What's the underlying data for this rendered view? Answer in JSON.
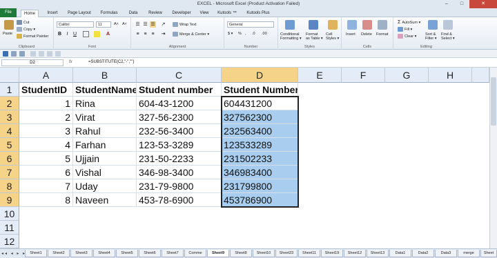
{
  "window": {
    "title": "EXCEL - Microsoft Excel (Product Activation Failed)",
    "buttons": [
      "–",
      "□",
      "✕"
    ]
  },
  "ribbon_tabs": [
    "File",
    "Home",
    "Insert",
    "Page Layout",
    "Formulas",
    "Data",
    "Review",
    "Developer",
    "View",
    "Kutools ™",
    "Kutools Plus"
  ],
  "active_tab": "Home",
  "ribbon": {
    "clipboard": {
      "paste": "Paste",
      "cut": "Cut",
      "copy": "Copy ▾",
      "format_painter": "Format Painter",
      "label": "Clipboard"
    },
    "font": {
      "name": "Calibri",
      "size": "11",
      "grow": "A˄",
      "shrink": "A˅",
      "bold": "B",
      "italic": "I",
      "underline": "U",
      "label": "Font"
    },
    "alignment": {
      "wrap_text": "Wrap Text",
      "merge_center": "Merge & Center ▾",
      "label": "Alignment"
    },
    "number": {
      "format": "General",
      "currency": "$ ▾",
      "percent": "%",
      "comma": ",",
      "inc_dec": ".0",
      "dec_dec": ".00",
      "label": "Number"
    },
    "styles": {
      "cond": "Conditional",
      "cond2": "Formatting ▾",
      "table": "Format",
      "table2": "as Table ▾",
      "cell": "Cell",
      "cell2": "Styles ▾",
      "label": "Styles"
    },
    "cells": {
      "insert": "Insert",
      "delete": "Delete",
      "format": "Format",
      "label": "Cells"
    },
    "editing": {
      "autosum": "AutoSum ▾",
      "fill": "Fill ▾",
      "clear": "Clear ▾",
      "sort": "Sort &",
      "sort2": "Filter ▾",
      "find": "Find &",
      "find2": "Select ▾",
      "label": "Editing"
    }
  },
  "formula_bar": {
    "name_box": "D2",
    "fx": "fx",
    "formula": "=SUBSTITUTE(C2,\"-\",\"\")"
  },
  "columns": [
    "A",
    "B",
    "C",
    "D",
    "E",
    "F",
    "G",
    "H"
  ],
  "selected_column": "D",
  "rows": [
    "1",
    "2",
    "3",
    "4",
    "5",
    "6",
    "7",
    "8",
    "9",
    "10",
    "11",
    "12"
  ],
  "table": {
    "header": [
      "StudentID",
      "StudentName",
      "Student number",
      "Student Number"
    ],
    "data": [
      [
        "1",
        "Rina",
        "604-43-1200",
        "604431200"
      ],
      [
        "2",
        "Virat",
        "327-56-2300",
        "327562300"
      ],
      [
        "3",
        "Rahul",
        "232-56-3400",
        "232563400"
      ],
      [
        "4",
        "Farhan",
        "123-53-3289",
        "123533289"
      ],
      [
        "5",
        "Ujjain",
        "231-50-2233",
        "231502233"
      ],
      [
        "6",
        "Vishal",
        "346-98-3400",
        "346983400"
      ],
      [
        "7",
        "Uday",
        "231-79-9800",
        "231799800"
      ],
      [
        "8",
        "Naveen",
        "453-78-6900",
        "453786900"
      ]
    ]
  },
  "sheet_nav": "◂◂ ◂ ▸ ▸▸",
  "sheets": [
    "Sheet1",
    "Sheet2",
    "Sheet3",
    "Sheet4",
    "Sheet5",
    "Sheet6",
    "Sheet7",
    "Comme",
    "Sheet9",
    "Sheet8",
    "Sheet10",
    "Sheet23",
    "Sheet11",
    "Sheet19",
    "Sheet12",
    "Sheet13",
    "Data1",
    "Data2",
    "Data3",
    "merge",
    "Sheet"
  ],
  "active_sheet": "Sheet9",
  "colors": {
    "file_tab": "#1f7a3a",
    "selection_fill": "#a8cdee",
    "header_selected": "#f5d48a"
  }
}
